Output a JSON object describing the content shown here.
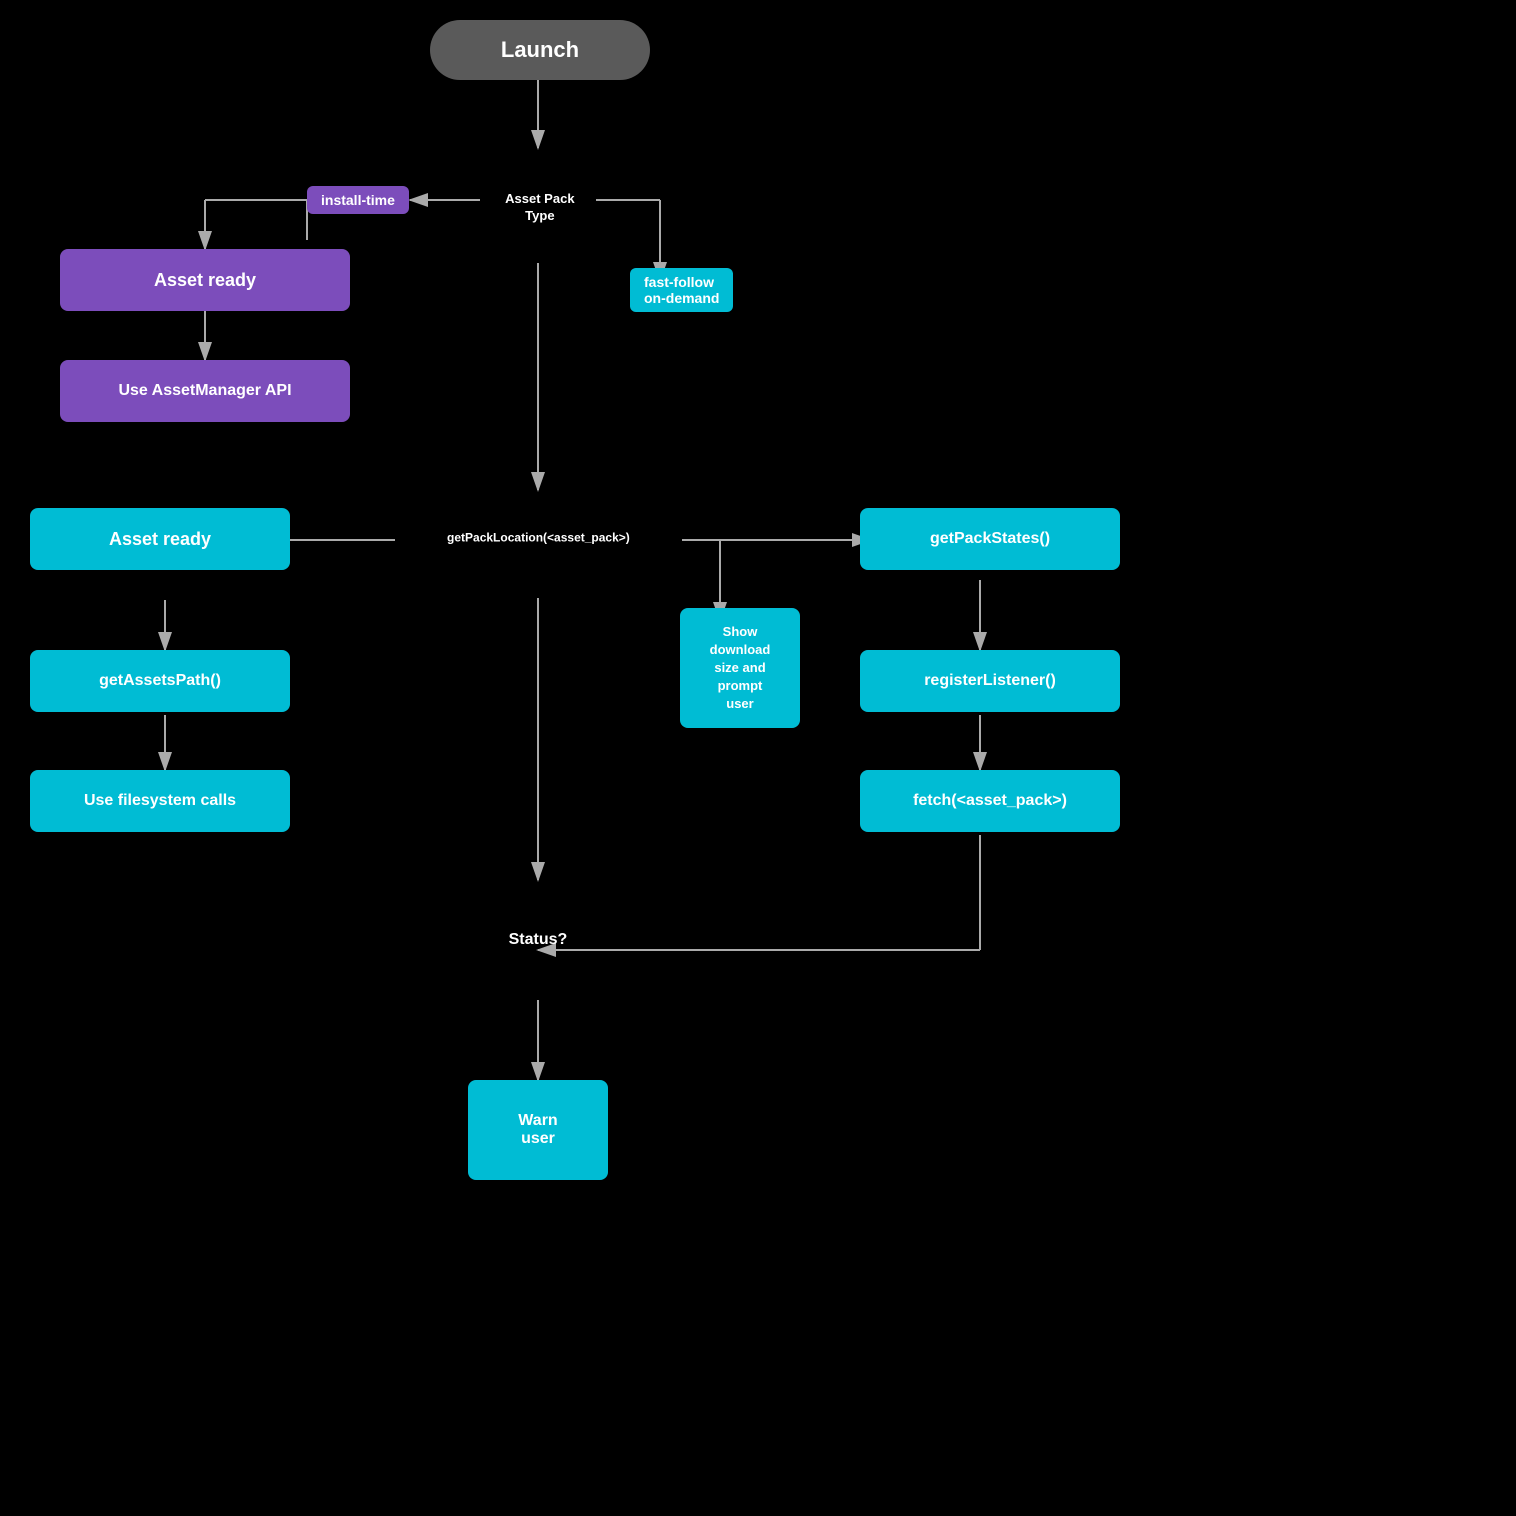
{
  "nodes": {
    "launch": {
      "label": "Launch"
    },
    "assetPackType": {
      "label": "Asset Pack\nType"
    },
    "installTime": {
      "label": "install-time"
    },
    "fastFollow": {
      "label": "fast-follow\non-demand"
    },
    "assetReady1": {
      "label": "Asset ready"
    },
    "useAssetManagerAPI": {
      "label": "Use AssetManager API"
    },
    "assetReady2": {
      "label": "Asset ready"
    },
    "getAssetsPath": {
      "label": "getAssetsPath()"
    },
    "useFilesystemCalls": {
      "label": "Use filesystem calls"
    },
    "getPackLocation": {
      "label": "getPackLocation(<asset_pack>)"
    },
    "showDownload": {
      "label": "Show\ndownload\nsize and\nprompt\nuser"
    },
    "getPackStates": {
      "label": "getPackStates()"
    },
    "registerListener": {
      "label": "registerListener()"
    },
    "fetchAssetPack": {
      "label": "fetch(<asset_pack>)"
    },
    "status": {
      "label": "Status?"
    },
    "warnUser": {
      "label": "Warn\nuser"
    }
  }
}
